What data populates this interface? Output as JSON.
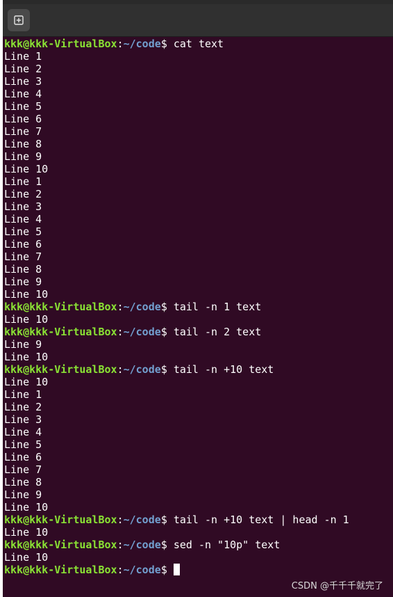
{
  "header": {
    "new_tab_icon": "new-tab-plus-icon"
  },
  "terminal": {
    "lines": [
      {
        "type": "prompt",
        "user": "kkk@kkk-VirtualBox",
        "sep": ":",
        "path": "~/code",
        "symbol": "$",
        "command": " cat text"
      },
      {
        "type": "output",
        "text": "Line 1"
      },
      {
        "type": "output",
        "text": "Line 2"
      },
      {
        "type": "output",
        "text": "Line 3"
      },
      {
        "type": "output",
        "text": "Line 4"
      },
      {
        "type": "output",
        "text": "Line 5"
      },
      {
        "type": "output",
        "text": "Line 6"
      },
      {
        "type": "output",
        "text": "Line 7"
      },
      {
        "type": "output",
        "text": "Line 8"
      },
      {
        "type": "output",
        "text": "Line 9"
      },
      {
        "type": "output",
        "text": "Line 10"
      },
      {
        "type": "output",
        "text": "Line 1"
      },
      {
        "type": "output",
        "text": "Line 2"
      },
      {
        "type": "output",
        "text": "Line 3"
      },
      {
        "type": "output",
        "text": "Line 4"
      },
      {
        "type": "output",
        "text": "Line 5"
      },
      {
        "type": "output",
        "text": "Line 6"
      },
      {
        "type": "output",
        "text": "Line 7"
      },
      {
        "type": "output",
        "text": "Line 8"
      },
      {
        "type": "output",
        "text": "Line 9"
      },
      {
        "type": "output",
        "text": "Line 10"
      },
      {
        "type": "prompt",
        "user": "kkk@kkk-VirtualBox",
        "sep": ":",
        "path": "~/code",
        "symbol": "$",
        "command": " tail -n 1 text"
      },
      {
        "type": "output",
        "text": "Line 10"
      },
      {
        "type": "prompt",
        "user": "kkk@kkk-VirtualBox",
        "sep": ":",
        "path": "~/code",
        "symbol": "$",
        "command": " tail -n 2 text"
      },
      {
        "type": "output",
        "text": "Line 9"
      },
      {
        "type": "output",
        "text": "Line 10"
      },
      {
        "type": "prompt",
        "user": "kkk@kkk-VirtualBox",
        "sep": ":",
        "path": "~/code",
        "symbol": "$",
        "command": " tail -n +10 text"
      },
      {
        "type": "output",
        "text": "Line 10"
      },
      {
        "type": "output",
        "text": "Line 1"
      },
      {
        "type": "output",
        "text": "Line 2"
      },
      {
        "type": "output",
        "text": "Line 3"
      },
      {
        "type": "output",
        "text": "Line 4"
      },
      {
        "type": "output",
        "text": "Line 5"
      },
      {
        "type": "output",
        "text": "Line 6"
      },
      {
        "type": "output",
        "text": "Line 7"
      },
      {
        "type": "output",
        "text": "Line 8"
      },
      {
        "type": "output",
        "text": "Line 9"
      },
      {
        "type": "output",
        "text": "Line 10"
      },
      {
        "type": "prompt",
        "user": "kkk@kkk-VirtualBox",
        "sep": ":",
        "path": "~/code",
        "symbol": "$",
        "command": " tail -n +10 text | head -n 1"
      },
      {
        "type": "output",
        "text": "Line 10"
      },
      {
        "type": "prompt",
        "user": "kkk@kkk-VirtualBox",
        "sep": ":",
        "path": "~/code",
        "symbol": "$",
        "command": " sed -n \"10p\" text"
      },
      {
        "type": "output",
        "text": "Line 10"
      },
      {
        "type": "prompt",
        "user": "kkk@kkk-VirtualBox",
        "sep": ":",
        "path": "~/code",
        "symbol": "$",
        "command": " ",
        "cursor": true
      }
    ]
  },
  "watermark": {
    "text": "CSDN @千千千就完了"
  },
  "colors": {
    "background": "#300a24",
    "prompt_user": "#8ae234",
    "prompt_path": "#729fcf",
    "text": "#ffffff"
  }
}
